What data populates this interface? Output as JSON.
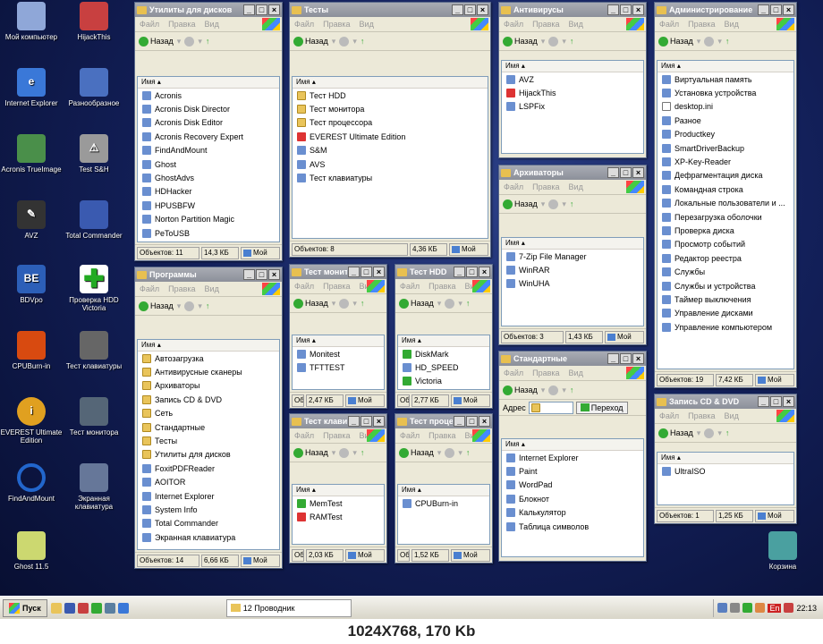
{
  "desktop_icons": [
    {
      "label": "Мой компьютер",
      "color": "#8fa7d8"
    },
    {
      "label": "HijackThis",
      "color": "#c84040"
    },
    {
      "label": "Internet Explorer",
      "color": "#3a78d8"
    },
    {
      "label": "Разнообразное",
      "color": "#4a70c0"
    },
    {
      "label": "Acronis TrueImage",
      "color": "#4a8f4a"
    },
    {
      "label": "Test S&H",
      "color": "#9a9a9a"
    },
    {
      "label": "AVZ",
      "color": "#333333"
    },
    {
      "label": "Total Commander",
      "color": "#3a5ab0"
    },
    {
      "label": "BDVpo",
      "color": "#2c5fb8"
    },
    {
      "label": "Проверка HDD Victoria",
      "color": "#22aa22"
    },
    {
      "label": "CPUBurn-in",
      "color": "#d84a10"
    },
    {
      "label": "Тест клавиатуры",
      "color": "#666666"
    },
    {
      "label": "EVEREST Ultimate Edition",
      "color": "#e0a020"
    },
    {
      "label": "Тест монитора",
      "color": "#556677"
    },
    {
      "label": "FindAndMount",
      "color": "#2266cc"
    },
    {
      "label": "Экранная клавиатура",
      "color": "#667799"
    },
    {
      "label": "Ghost 11.5",
      "color": "#ccd870"
    },
    {
      "label": "Корзина",
      "color": "#4aa0a0"
    }
  ],
  "win_common": {
    "menu": [
      "Файл",
      "Правка",
      "Вид"
    ],
    "back": "Назад",
    "address": "Адрес",
    "go": "Переход",
    "col_name": "Имя",
    "status_pc": "Мой"
  },
  "windows": [
    {
      "title": "Утилиты для дисков",
      "items": [
        {
          "t": "Acronis",
          "c": "prog"
        },
        {
          "t": "Acronis Disk Director",
          "c": "prog"
        },
        {
          "t": "Acronis Disk Editor",
          "c": "prog"
        },
        {
          "t": "Acronis Recovery Expert",
          "c": "prog"
        },
        {
          "t": "FindAndMount",
          "c": "prog"
        },
        {
          "t": "Ghost",
          "c": "prog"
        },
        {
          "t": "GhostAdvs",
          "c": "prog"
        },
        {
          "t": "HDHacker",
          "c": "prog"
        },
        {
          "t": "HPUSBFW",
          "c": "prog"
        },
        {
          "t": "Norton Partition Magic",
          "c": "prog"
        },
        {
          "t": "PeToUSB",
          "c": "prog"
        }
      ],
      "status": "Объектов: 11",
      "size": "14,3 КБ"
    },
    {
      "title": "Тесты",
      "items": [
        {
          "t": "Тест HDD",
          "c": "folder"
        },
        {
          "t": "Тест монитора",
          "c": "folder"
        },
        {
          "t": "Тест процессора",
          "c": "folder"
        },
        {
          "t": "EVEREST Ultimate Edition",
          "c": "red"
        },
        {
          "t": "S&M",
          "c": "prog"
        },
        {
          "t": "AVS",
          "c": "prog"
        },
        {
          "t": "Тест клавиатуры",
          "c": "prog"
        }
      ],
      "status": "Объектов: 8",
      "size": "4,36 КБ"
    },
    {
      "title": "Антивирусы",
      "items": [
        {
          "t": "AVZ",
          "c": "prog"
        },
        {
          "t": "HijackThis",
          "c": "red"
        },
        {
          "t": "LSPFix",
          "c": "prog"
        }
      ],
      "status": "",
      "size": ""
    },
    {
      "title": "Администрирование",
      "items": [
        {
          "t": "Виртуальная память",
          "c": "prog"
        },
        {
          "t": "Установка устройства",
          "c": "prog"
        },
        {
          "t": "desktop.ini",
          "c": "doc"
        },
        {
          "t": "Разное",
          "c": "prog"
        },
        {
          "t": "Productkey",
          "c": "prog"
        },
        {
          "t": "SmartDriverBackup",
          "c": "prog"
        },
        {
          "t": "XP-Key-Reader",
          "c": "prog"
        },
        {
          "t": "Дефрагментация диска",
          "c": "prog"
        },
        {
          "t": "Командная строка",
          "c": "prog"
        },
        {
          "t": "Локальные пользователи и ...",
          "c": "prog"
        },
        {
          "t": "Перезагрузка оболочки",
          "c": "prog"
        },
        {
          "t": "Проверка диска",
          "c": "prog"
        },
        {
          "t": "Просмотр событий",
          "c": "prog"
        },
        {
          "t": "Редактор реестра",
          "c": "prog"
        },
        {
          "t": "Службы",
          "c": "prog"
        },
        {
          "t": "Службы и устройства",
          "c": "prog"
        },
        {
          "t": "Таймер выключения",
          "c": "prog"
        },
        {
          "t": "Управление дисками",
          "c": "prog"
        },
        {
          "t": "Управление компьютером",
          "c": "prog"
        }
      ],
      "status": "Объектов: 19",
      "size": "7,42 КБ"
    },
    {
      "title": "Архиваторы",
      "items": [
        {
          "t": "7-Zip File Manager",
          "c": "prog"
        },
        {
          "t": "WinRAR",
          "c": "prog"
        },
        {
          "t": "WinUHA",
          "c": "prog"
        }
      ],
      "status": "Объектов: 3",
      "size": "1,43 КБ"
    },
    {
      "title": "Программы",
      "items": [
        {
          "t": "Автозагрузка",
          "c": "folder"
        },
        {
          "t": "Антивирусные сканеры",
          "c": "folder"
        },
        {
          "t": "Архиваторы",
          "c": "folder"
        },
        {
          "t": "Запись CD & DVD",
          "c": "folder"
        },
        {
          "t": "Сеть",
          "c": "folder"
        },
        {
          "t": "Стандартные",
          "c": "folder"
        },
        {
          "t": "Тесты",
          "c": "folder"
        },
        {
          "t": "Утилиты для дисков",
          "c": "folder"
        },
        {
          "t": "FoxitPDFReader",
          "c": "prog"
        },
        {
          "t": "AOITOR",
          "c": "prog"
        },
        {
          "t": "Internet Explorer",
          "c": "prog"
        },
        {
          "t": "System Info",
          "c": "prog"
        },
        {
          "t": "Total Commander",
          "c": "prog"
        },
        {
          "t": "Экранная клавиатура",
          "c": "prog"
        }
      ],
      "status": "Объектов: 14",
      "size": "6,66 КБ"
    },
    {
      "title": "Тест монитора",
      "items": [
        {
          "t": "Monitest",
          "c": "prog"
        },
        {
          "t": "TFTTEST",
          "c": "prog"
        }
      ],
      "status": "Объе",
      "size": "2,47 КБ"
    },
    {
      "title": "Тест HDD",
      "items": [
        {
          "t": "DiskMark",
          "c": "grn"
        },
        {
          "t": "HD_SPEED",
          "c": "prog"
        },
        {
          "t": "Victoria",
          "c": "grn"
        }
      ],
      "status": "Объе",
      "size": "2,77 КБ"
    },
    {
      "title": "Стандартные",
      "items": [
        {
          "t": "Internet Explorer",
          "c": "prog"
        },
        {
          "t": "Paint",
          "c": "prog"
        },
        {
          "t": "WordPad",
          "c": "prog"
        },
        {
          "t": "Блокнот",
          "c": "prog"
        },
        {
          "t": "Калькулятор",
          "c": "prog"
        },
        {
          "t": "Таблица символов",
          "c": "prog"
        }
      ],
      "status": "",
      "size": ""
    },
    {
      "title": "Тест клавиатуры",
      "items": [
        {
          "t": "MemTest",
          "c": "grn"
        },
        {
          "t": "RAMTest",
          "c": "red"
        }
      ],
      "status": "Объе",
      "size": "2,03 КБ"
    },
    {
      "title": "Тест процессора",
      "items": [
        {
          "t": "CPUBurn-in",
          "c": "prog"
        }
      ],
      "status": "Объе",
      "size": "1,52 КБ"
    },
    {
      "title": "Запись CD & DVD",
      "items": [
        {
          "t": "UltraISO",
          "c": "prog"
        }
      ],
      "status": "Объектов: 1",
      "size": "1,25 КБ"
    }
  ],
  "taskbar": {
    "start": "Пуск",
    "task": "12 Проводник",
    "clock": "22:13",
    "lang": "En"
  },
  "caption": "1024X768, 170 Kb"
}
